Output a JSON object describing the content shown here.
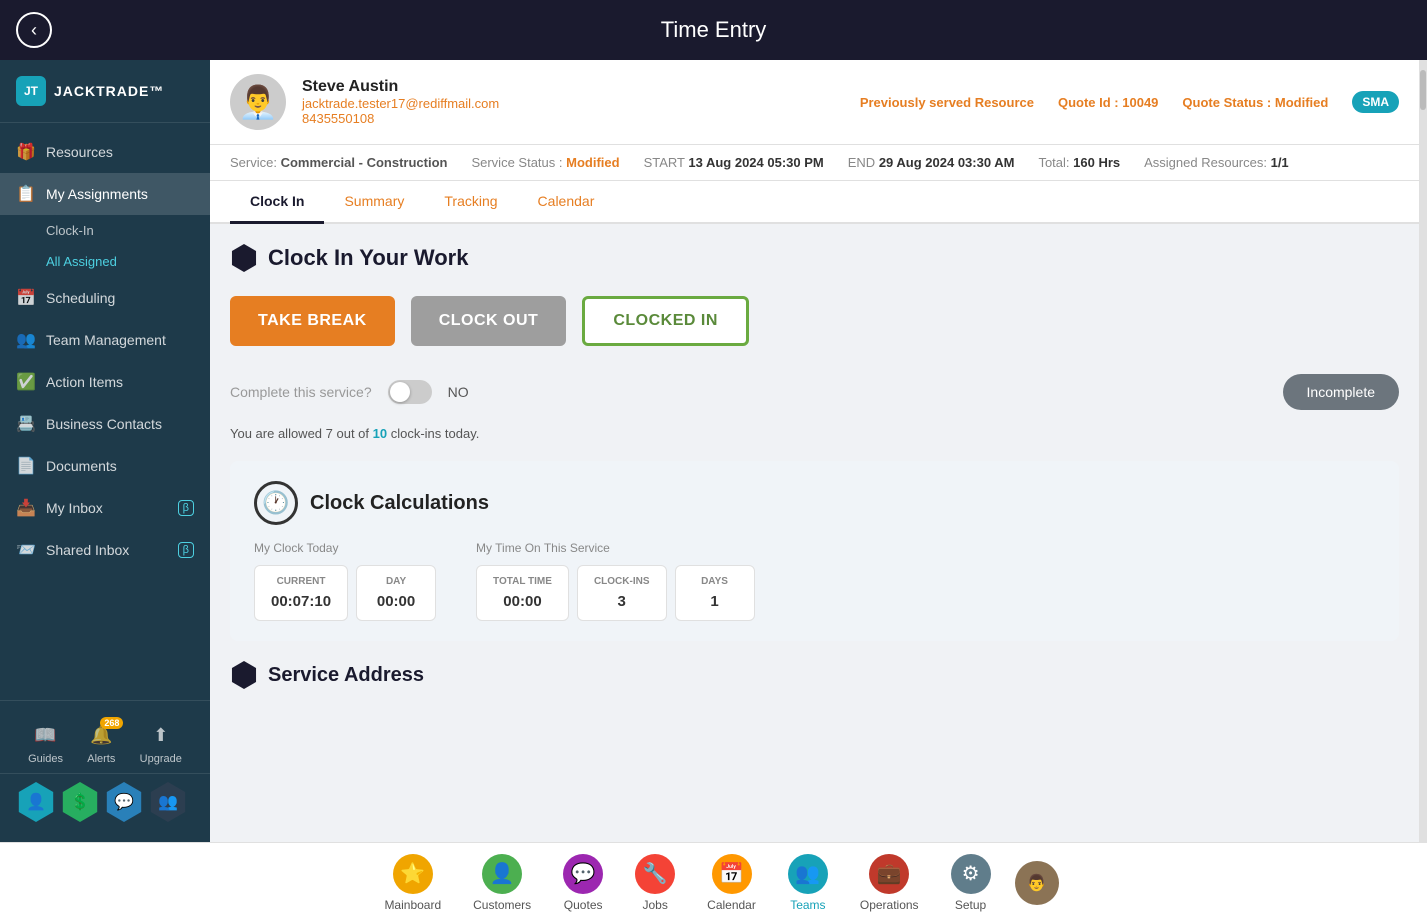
{
  "topbar": {
    "title": "Time Entry",
    "back_icon": "‹"
  },
  "sidebar": {
    "logo_text": "JACKTRADE™",
    "nav_items": [
      {
        "id": "resources",
        "label": "Resources",
        "icon": "🎁"
      },
      {
        "id": "my-assignments",
        "label": "My Assignments",
        "icon": "📋",
        "active": true
      },
      {
        "id": "clock-in",
        "label": "Clock-In",
        "sub": true
      },
      {
        "id": "all-assigned",
        "label": "All Assigned",
        "sub": true,
        "active_sub": true
      },
      {
        "id": "scheduling",
        "label": "Scheduling",
        "icon": "📅"
      },
      {
        "id": "team-management",
        "label": "Team Management",
        "icon": "👥"
      },
      {
        "id": "action-items",
        "label": "Action Items",
        "icon": "✅"
      },
      {
        "id": "business-contacts",
        "label": "Business Contacts",
        "icon": "📇"
      },
      {
        "id": "documents",
        "label": "Documents",
        "icon": "📄"
      },
      {
        "id": "my-inbox",
        "label": "My Inbox",
        "icon": "📥",
        "badge": "β"
      },
      {
        "id": "shared-inbox",
        "label": "Shared Inbox",
        "icon": "📨",
        "badge": "β"
      }
    ],
    "bottom_icons": [
      {
        "id": "guides",
        "label": "Guides",
        "icon": "📖"
      },
      {
        "id": "alerts",
        "label": "Alerts",
        "icon": "🔔",
        "badge": "268"
      },
      {
        "id": "upgrade",
        "label": "Upgrade",
        "icon": "⬆"
      }
    ],
    "hex_icons": [
      {
        "id": "person",
        "icon": "👤",
        "color": "hex-teal"
      },
      {
        "id": "dollar",
        "icon": "💲",
        "color": "hex-green"
      },
      {
        "id": "chat",
        "icon": "💬",
        "color": "hex-blue"
      },
      {
        "id": "group",
        "icon": "👥",
        "color": "hex-dark"
      }
    ]
  },
  "customer": {
    "name": "Steve Austin",
    "email": "jacktrade.tester17@rediffmail.com",
    "phone": "8435550108",
    "previously_served_label": "Previously served Resource",
    "quote_id_label": "Quote Id :",
    "quote_id_value": "10049",
    "quote_status_label": "Quote Status :",
    "quote_status_value": "Modified",
    "sma_badge": "SMA",
    "avatar_icon": "👨‍💼"
  },
  "service_bar": {
    "service_label": "Service:",
    "service_value": "Commercial - Construction",
    "status_label": "Service Status :",
    "status_value": "Modified",
    "start_label": "START",
    "start_value": "13 Aug 2024 05:30 PM",
    "end_label": "END",
    "end_value": "29 Aug 2024 03:30 AM",
    "total_label": "Total:",
    "total_value": "160 Hrs",
    "assigned_label": "Assigned Resources:",
    "assigned_value": "1/1"
  },
  "tabs": [
    {
      "id": "clock-in",
      "label": "Clock In",
      "active": true
    },
    {
      "id": "summary",
      "label": "Summary"
    },
    {
      "id": "tracking",
      "label": "Tracking"
    },
    {
      "id": "calendar",
      "label": "Calendar"
    }
  ],
  "clock_in_section": {
    "title": "Clock In Your Work",
    "btn_take_break": "TAKE BREAK",
    "btn_clock_out": "CLOCK OUT",
    "btn_clocked_in": "CLOCKED IN",
    "complete_label": "Complete this service?",
    "toggle_state": "NO",
    "btn_incomplete": "Incomplete",
    "allowed_text_pre": "You are allowed 7 out of ",
    "allowed_highlight": "10",
    "allowed_text_post": " clock-ins today."
  },
  "clock_calculations": {
    "title": "Clock Calculations",
    "my_clock_label": "My Clock Today",
    "my_time_label": "My Time On This Service",
    "cols_clock": [
      {
        "header": "CURRENT",
        "value": "00:07:10"
      },
      {
        "header": "DAY",
        "value": "00:00"
      }
    ],
    "cols_service": [
      {
        "header": "TOTAL TIME",
        "value": "00:00"
      },
      {
        "header": "CLOCK-INS",
        "value": "3"
      },
      {
        "header": "DAYS",
        "value": "1"
      }
    ]
  },
  "service_address": {
    "title": "Service Address"
  },
  "bottom_nav": {
    "items": [
      {
        "id": "mainboard",
        "label": "Mainboard",
        "icon": "⭐",
        "color": "nav-icon-yellow"
      },
      {
        "id": "customers",
        "label": "Customers",
        "icon": "👤",
        "color": "nav-icon-green"
      },
      {
        "id": "quotes",
        "label": "Quotes",
        "icon": "💬",
        "color": "nav-icon-purple"
      },
      {
        "id": "jobs",
        "label": "Jobs",
        "icon": "🔧",
        "color": "nav-icon-red"
      },
      {
        "id": "calendar",
        "label": "Calendar",
        "icon": "📅",
        "color": "nav-icon-orange"
      },
      {
        "id": "teams",
        "label": "Teams",
        "icon": "👥",
        "color": "nav-icon-teal",
        "active": true
      },
      {
        "id": "operations",
        "label": "Operations",
        "icon": "💼",
        "color": "nav-icon-darkred"
      },
      {
        "id": "setup",
        "label": "Setup",
        "icon": "⚙",
        "color": "nav-icon-gray"
      }
    ]
  }
}
